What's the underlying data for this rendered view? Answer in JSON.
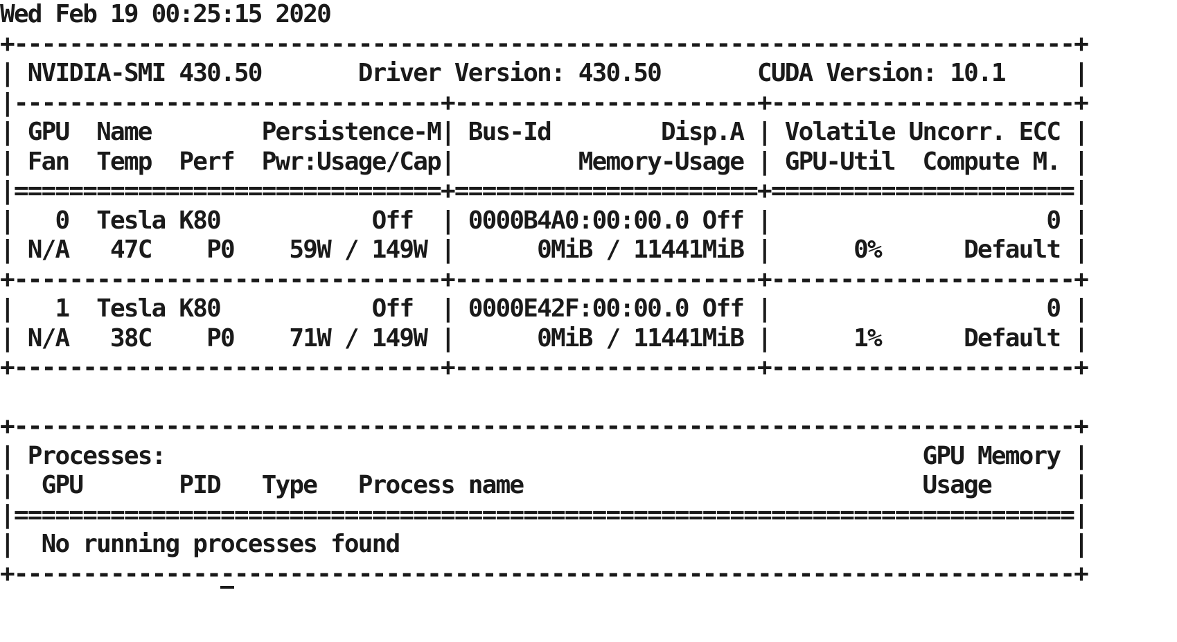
{
  "terminal": {
    "lines": [
      "Wed Feb 19 00:25:15 2020",
      "+-----------------------------------------------------------------------------+",
      "| NVIDIA-SMI 430.50       Driver Version: 430.50       CUDA Version: 10.1     |",
      "|-------------------------------+----------------------+----------------------+",
      "| GPU  Name        Persistence-M| Bus-Id        Disp.A | Volatile Uncorr. ECC |",
      "| Fan  Temp  Perf  Pwr:Usage/Cap|         Memory-Usage | GPU-Util  Compute M. |",
      "|===============================+======================+======================|",
      "|   0  Tesla K80           Off  | 0000B4A0:00:00.0 Off |                    0 |",
      "| N/A   47C    P0    59W / 149W |      0MiB / 11441MiB |      0%      Default |",
      "+-------------------------------+----------------------+----------------------+",
      "|   1  Tesla K80           Off  | 0000E42F:00:00.0 Off |                    0 |",
      "| N/A   38C    P0    71W / 149W |      0MiB / 11441MiB |      1%      Default |",
      "+-------------------------------+----------------------+----------------------+",
      "",
      "+-----------------------------------------------------------------------------+",
      "| Processes:                                                       GPU Memory |",
      "|  GPU       PID   Type   Process name                             Usage      |",
      "|=============================================================================|",
      "|  No running processes found                                                 |",
      "+-----------------------------------------------------------------------------+"
    ]
  }
}
